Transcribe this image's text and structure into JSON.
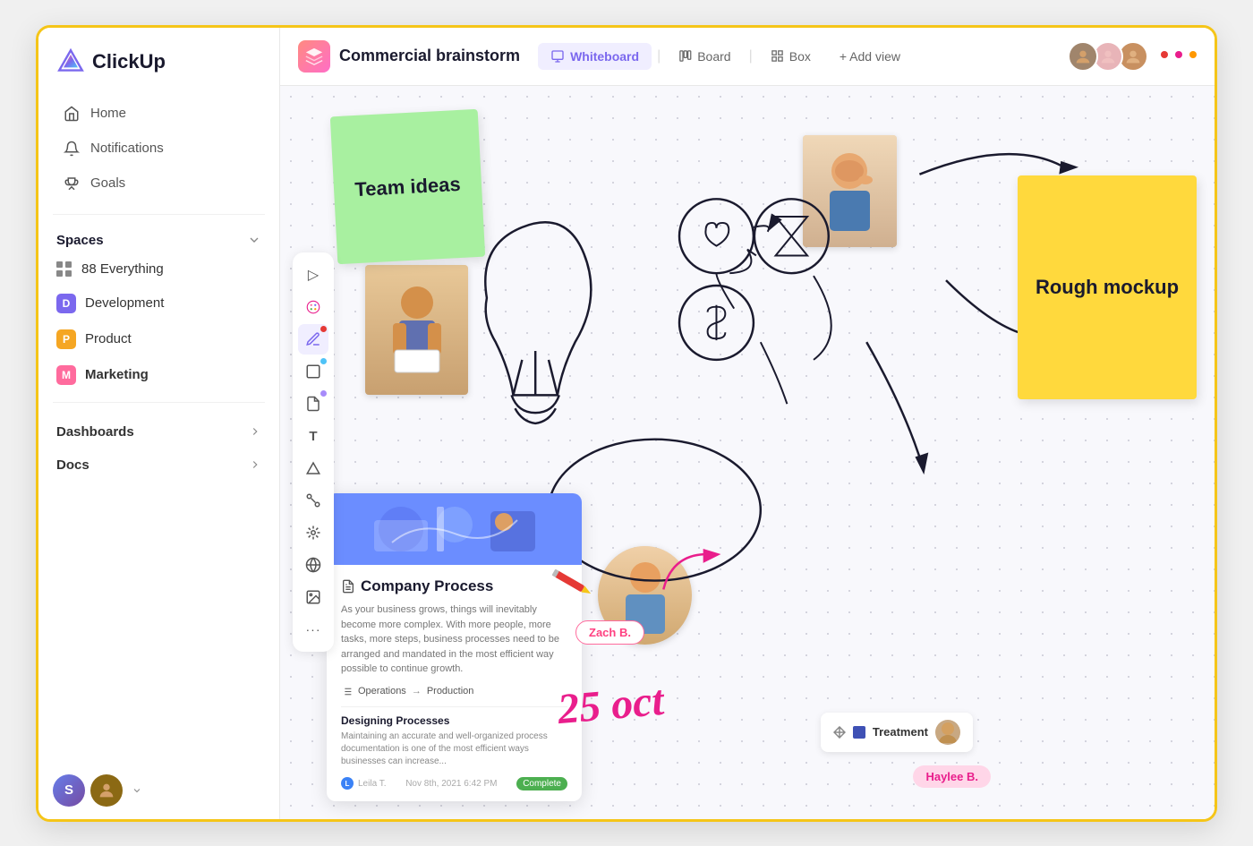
{
  "app": {
    "name": "ClickUp"
  },
  "sidebar": {
    "nav": [
      {
        "id": "home",
        "label": "Home",
        "icon": "home"
      },
      {
        "id": "notifications",
        "label": "Notifications",
        "icon": "bell"
      },
      {
        "id": "goals",
        "label": "Goals",
        "icon": "trophy"
      }
    ],
    "spaces_label": "Spaces",
    "spaces": [
      {
        "id": "everything",
        "label": "Everything",
        "type": "grid",
        "count": "88"
      },
      {
        "id": "development",
        "label": "Development",
        "color": "#7B68EE",
        "letter": "D"
      },
      {
        "id": "product",
        "label": "Product",
        "color": "#F5A623",
        "letter": "P"
      },
      {
        "id": "marketing",
        "label": "Marketing",
        "color": "#FF6B9D",
        "letter": "M",
        "bold": true
      }
    ],
    "bottom_items": [
      {
        "id": "dashboards",
        "label": "Dashboards"
      },
      {
        "id": "docs",
        "label": "Docs"
      }
    ]
  },
  "topbar": {
    "title": "Commercial brainstorm",
    "tabs": [
      {
        "id": "whiteboard",
        "label": "Whiteboard",
        "active": true
      },
      {
        "id": "board",
        "label": "Board",
        "active": false
      },
      {
        "id": "box",
        "label": "Box",
        "active": false
      }
    ],
    "add_view": "+ Add view"
  },
  "whiteboard": {
    "sticky_green": "Team ideas",
    "sticky_yellow": "Rough mockup",
    "date_label": "25 oct",
    "doc_title": "Company Process",
    "doc_text": "As your business grows, things will inevitably become more complex. With more people, more tasks, more steps, business processes need to be arranged and mandated in the most efficient way possible to continue growth.",
    "doc_flow_from": "Operations",
    "doc_flow_to": "Production",
    "doc_sub_title": "Designing Processes",
    "doc_sub_text": "Maintaining an accurate and well-organized process documentation is one of the most efficient ways businesses can increase...",
    "doc_footer_user": "Leila T.",
    "doc_footer_date": "Nov 8th, 2021  6:42 PM",
    "doc_tag": "Complete",
    "label_zach": "Zach B.",
    "label_haylee": "Haylee B.",
    "treatment_label": "Treatment"
  },
  "toolbar": {
    "tools": [
      {
        "id": "cursor",
        "icon": "▷"
      },
      {
        "id": "palette",
        "icon": "✦"
      },
      {
        "id": "pen",
        "icon": "✏"
      },
      {
        "id": "rect",
        "icon": "□"
      },
      {
        "id": "note",
        "icon": "◱"
      },
      {
        "id": "text",
        "icon": "T"
      },
      {
        "id": "shape",
        "icon": "⟋"
      },
      {
        "id": "connect",
        "icon": "⊛"
      },
      {
        "id": "star",
        "icon": "✳"
      },
      {
        "id": "globe",
        "icon": "⊕"
      },
      {
        "id": "image",
        "icon": "⊡"
      },
      {
        "id": "more",
        "icon": "⋯"
      }
    ]
  },
  "collab": {
    "avatars": [
      {
        "id": "a1",
        "color": "#a0856c",
        "dot": "#e53935"
      },
      {
        "id": "a2",
        "color": "#d4a0a0",
        "dot": "#e91e8c"
      },
      {
        "id": "a3",
        "color": "#c8956c",
        "dot": "#FF9800"
      }
    ]
  }
}
